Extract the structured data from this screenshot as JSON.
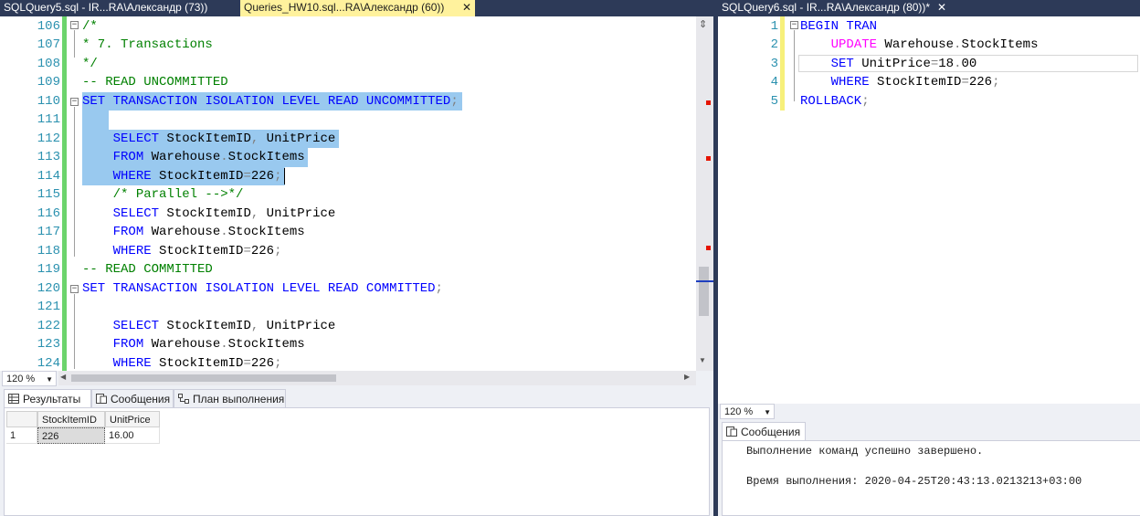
{
  "left_tabs": [
    {
      "label": "SQLQuery5.sql - IR...RA\\Александр (73))",
      "active": false
    },
    {
      "label": "Queries_HW10.sql...RA\\Александр (60))",
      "active": true,
      "close": "✕"
    }
  ],
  "right_tab": {
    "label": "SQLQuery6.sql - IR...RA\\Александр (80))*",
    "close": "✕"
  },
  "left_editor": {
    "zoom": "120 %",
    "lines": [
      {
        "n": "106",
        "code": "/*"
      },
      {
        "n": "107",
        "code": "* 7. Transactions"
      },
      {
        "n": "108",
        "code": "*/"
      },
      {
        "n": "109",
        "code": "-- READ UNCOMMITTED"
      },
      {
        "n": "110",
        "code": "SET TRANSACTION ISOLATION LEVEL READ UNCOMMITTED;"
      },
      {
        "n": "111",
        "code": ""
      },
      {
        "n": "112",
        "code": "    SELECT StockItemID, UnitPrice"
      },
      {
        "n": "113",
        "code": "    FROM Warehouse.StockItems"
      },
      {
        "n": "114",
        "code": "    WHERE StockItemID=226;"
      },
      {
        "n": "115",
        "code": "    /* Parallel -->*/"
      },
      {
        "n": "116",
        "code": "    SELECT StockItemID, UnitPrice"
      },
      {
        "n": "117",
        "code": "    FROM Warehouse.StockItems"
      },
      {
        "n": "118",
        "code": "    WHERE StockItemID=226;"
      },
      {
        "n": "119",
        "code": "-- READ COMMITTED"
      },
      {
        "n": "120",
        "code": "SET TRANSACTION ISOLATION LEVEL READ COMMITTED;"
      },
      {
        "n": "121",
        "code": ""
      },
      {
        "n": "122",
        "code": "    SELECT StockItemID, UnitPrice"
      },
      {
        "n": "123",
        "code": "    FROM Warehouse.StockItems"
      },
      {
        "n": "124",
        "code": "    WHERE StockItemID=226;"
      }
    ]
  },
  "right_editor": {
    "zoom": "120 %",
    "lines": [
      {
        "n": "1",
        "code": "BEGIN TRAN"
      },
      {
        "n": "2",
        "code": "    UPDATE Warehouse.StockItems"
      },
      {
        "n": "3",
        "code": "    SET UnitPrice=18.00"
      },
      {
        "n": "4",
        "code": "    WHERE StockItemID=226;"
      },
      {
        "n": "5",
        "code": "ROLLBACK;"
      }
    ]
  },
  "left_results": {
    "tabs": [
      {
        "label": "Результаты",
        "icon": "grid-icon",
        "active": true
      },
      {
        "label": "Сообщения",
        "icon": "messages-icon",
        "active": false
      },
      {
        "label": "План выполнения",
        "icon": "execution-plan-icon",
        "active": false
      }
    ],
    "columns": [
      "StockItemID",
      "UnitPrice"
    ],
    "rows": [
      {
        "row_num": "1",
        "cells": [
          "226",
          "16.00"
        ]
      }
    ]
  },
  "right_results": {
    "tab": {
      "label": "Сообщения",
      "icon": "messages-icon"
    },
    "messages": [
      "Выполнение команд успешно завершено.",
      "",
      "Время выполнения: 2020-04-25T20:43:13.0213213+03:00"
    ]
  },
  "colors": {
    "keyword": "#0000ff",
    "comment": "#008000",
    "function": "#ff00ff",
    "operator": "#808080",
    "line_number": "#2b91af",
    "selection": "#99c9ef",
    "change_bar": "#6cd46c",
    "unsaved_bar": "#f7f07a",
    "title_bar": "#2d3a58",
    "active_tab": "#fff29d"
  }
}
